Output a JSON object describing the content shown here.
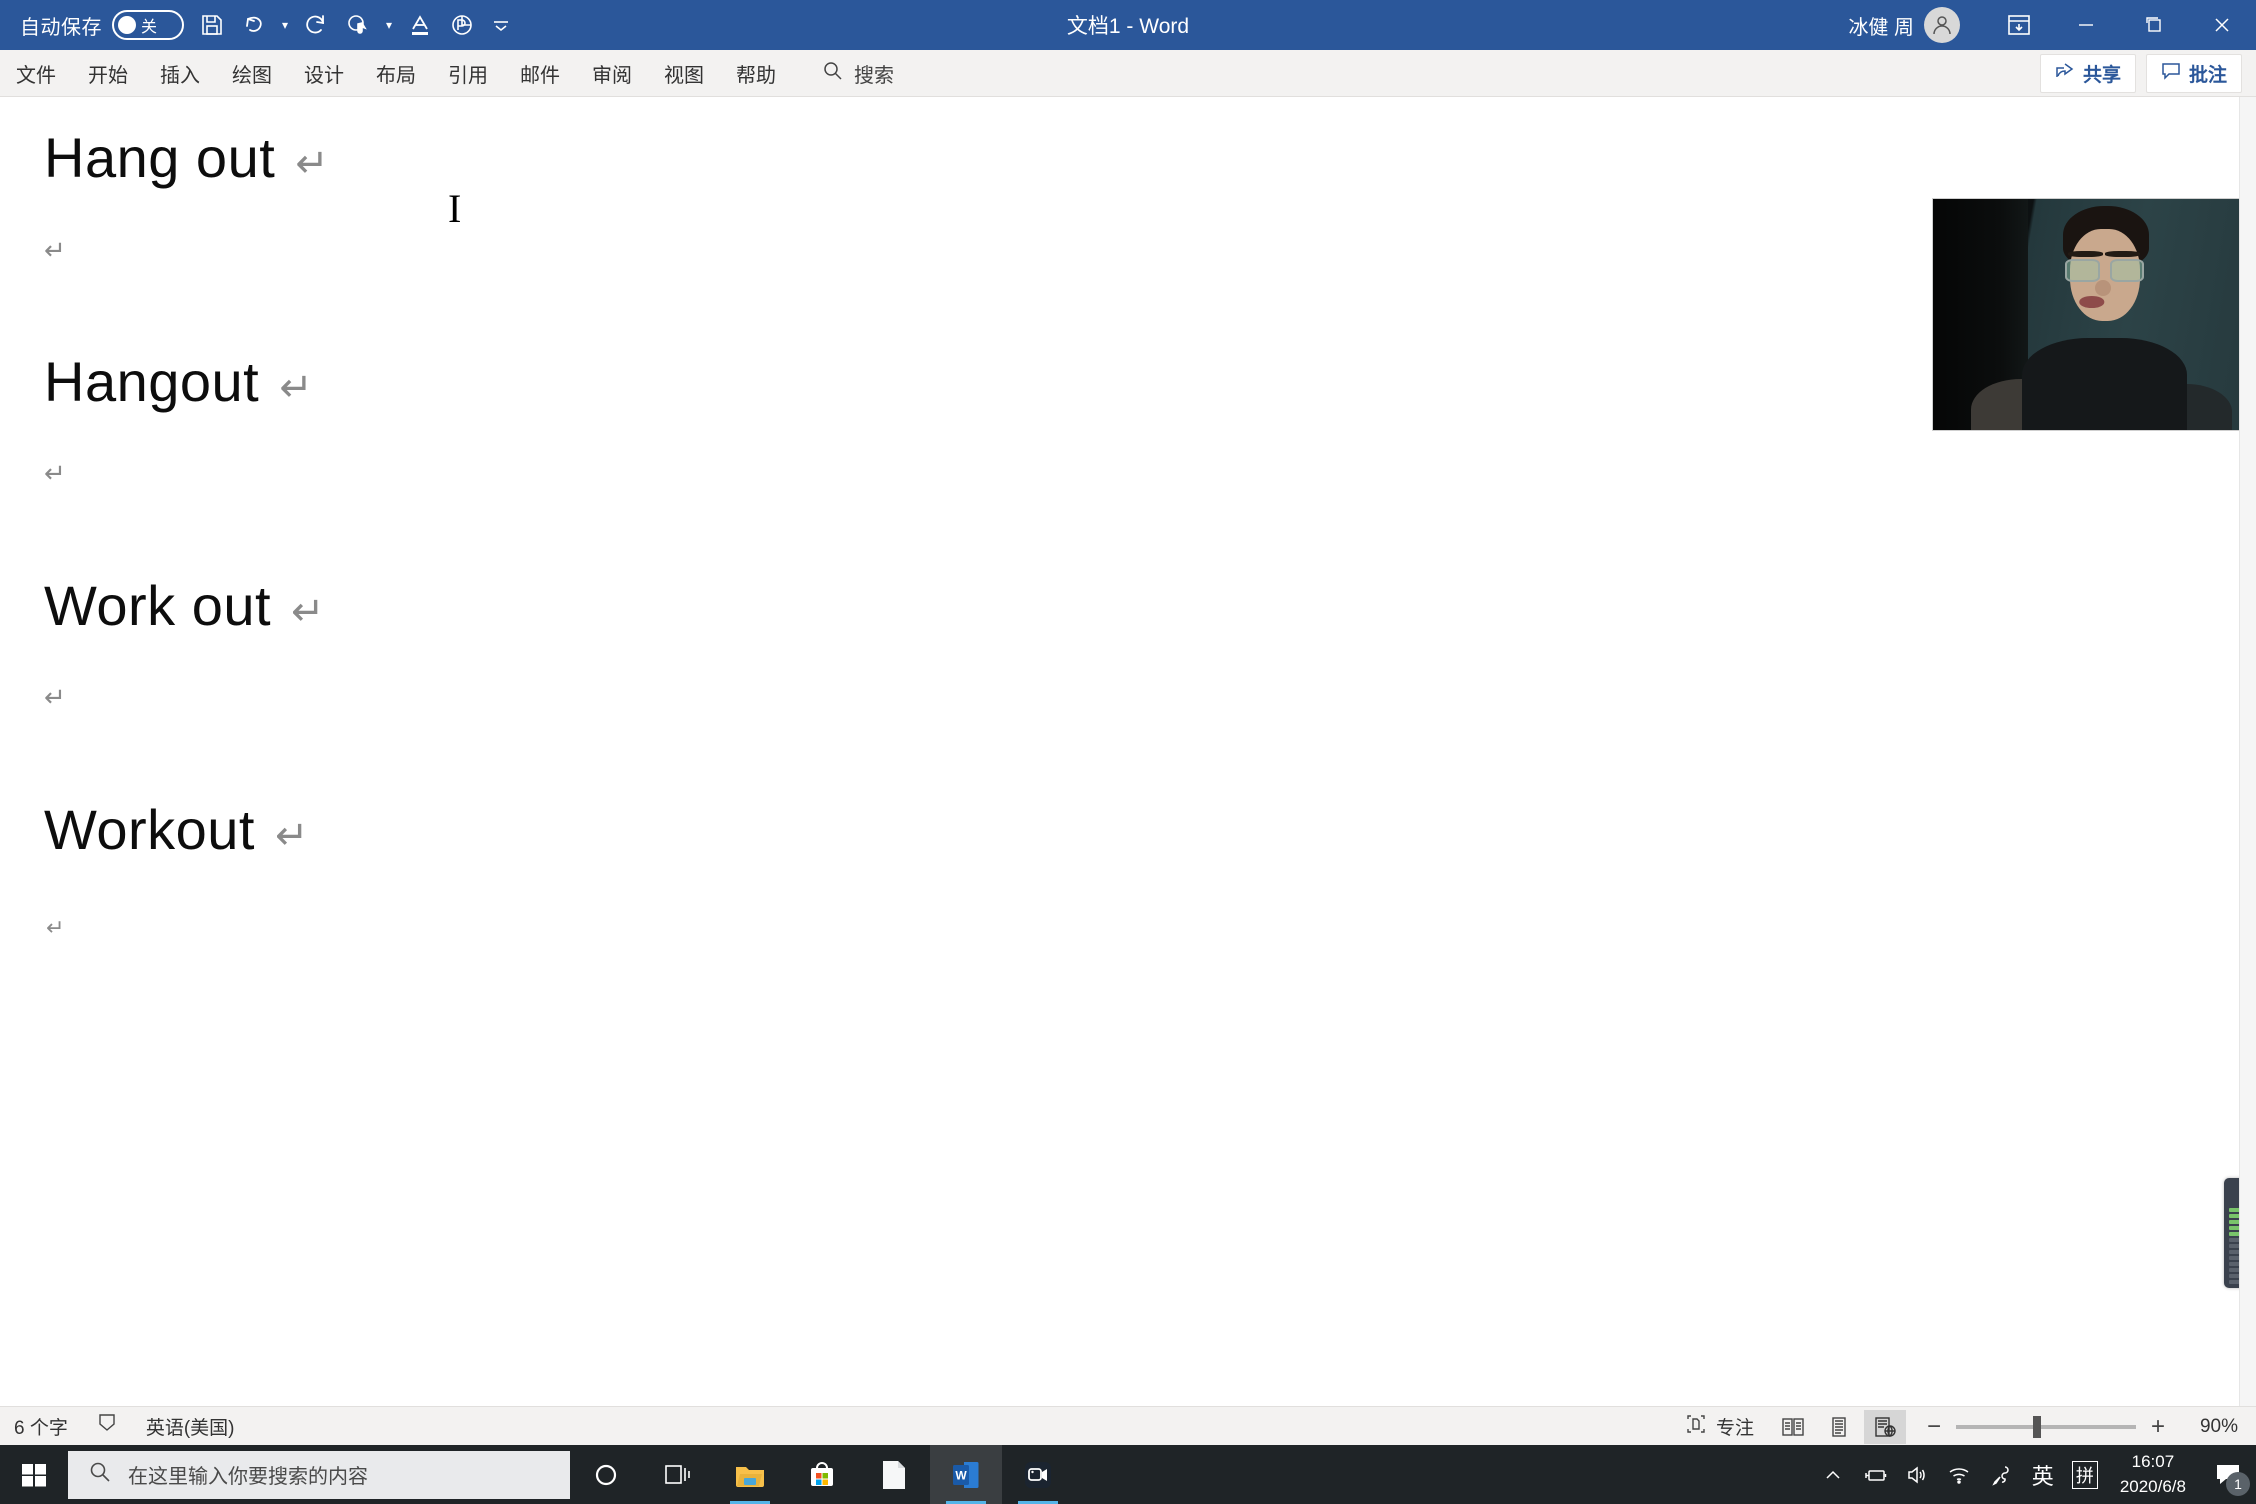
{
  "titlebar": {
    "autosave_label": "自动保存",
    "autosave_state": "关",
    "document_title": "文档1  -  Word",
    "account_name": "冰健 周",
    "quick_access": [
      {
        "name": "save-icon",
        "tooltip": "保存"
      },
      {
        "name": "undo-icon",
        "tooltip": "撤消"
      },
      {
        "name": "redo-icon",
        "tooltip": "恢复"
      },
      {
        "name": "touch-mode-icon",
        "tooltip": "触摸/鼠标模式"
      },
      {
        "name": "font-color-icon",
        "tooltip": "字体颜色"
      },
      {
        "name": "powerpoint-icon",
        "tooltip": "演示"
      },
      {
        "name": "customize-qat-icon",
        "tooltip": "自定义快速访问工具栏"
      }
    ],
    "window_buttons": {
      "ribbon_display": "功能区显示选项",
      "minimize": "最小化",
      "maximize": "最大化",
      "close": "关闭"
    },
    "bg_color": "#2b579a"
  },
  "ribbon": {
    "tabs": [
      {
        "label": "文件"
      },
      {
        "label": "开始"
      },
      {
        "label": "插入"
      },
      {
        "label": "绘图"
      },
      {
        "label": "设计"
      },
      {
        "label": "布局"
      },
      {
        "label": "引用"
      },
      {
        "label": "邮件"
      },
      {
        "label": "审阅"
      },
      {
        "label": "视图"
      },
      {
        "label": "帮助"
      }
    ],
    "search_label": "搜索",
    "share_label": "共享",
    "comments_label": "批注",
    "accent_color": "#2b579a"
  },
  "document": {
    "lines": [
      {
        "text": "Hang out",
        "mark": "↵",
        "size": "large"
      },
      {
        "text": "",
        "mark": "↵",
        "size": "small"
      },
      {
        "text": "Hangout",
        "mark": "↵",
        "size": "large"
      },
      {
        "text": "",
        "mark": "↵",
        "size": "small"
      },
      {
        "text": "Work out",
        "mark": "↵",
        "size": "large"
      },
      {
        "text": "",
        "mark": "↵",
        "size": "small"
      },
      {
        "text": "Workout",
        "mark": "↵",
        "size": "large"
      },
      {
        "text": "",
        "mark": "↵",
        "size": "tiny"
      }
    ],
    "cursor_glyph": "I"
  },
  "statusbar": {
    "word_count": "6 个字",
    "proofing_icon": "proofing-icon",
    "language": "英语(美国)",
    "focus_label": "专注",
    "views": [
      {
        "name": "read-mode-icon",
        "active": false
      },
      {
        "name": "print-layout-icon",
        "active": false
      },
      {
        "name": "web-layout-icon",
        "active": true
      }
    ],
    "zoom_minus": "−",
    "zoom_plus": "+",
    "zoom_level": "90%"
  },
  "taskbar": {
    "search_placeholder": "在这里输入你要搜索的内容",
    "items": [
      {
        "name": "cortana-icon",
        "running": false,
        "active": false
      },
      {
        "name": "task-view-icon",
        "running": false,
        "active": false
      },
      {
        "name": "file-explorer-icon",
        "running": true,
        "active": false
      },
      {
        "name": "microsoft-store-icon",
        "running": false,
        "active": false
      },
      {
        "name": "notepad-icon",
        "running": false,
        "active": false
      },
      {
        "name": "word-icon",
        "running": true,
        "active": true
      },
      {
        "name": "camera-recorder-icon",
        "running": true,
        "active": false
      }
    ],
    "tray": {
      "ime_language": "英",
      "ime_mode": "拼",
      "time": "16:07",
      "date": "2020/6/8",
      "notification_count": "1"
    }
  }
}
